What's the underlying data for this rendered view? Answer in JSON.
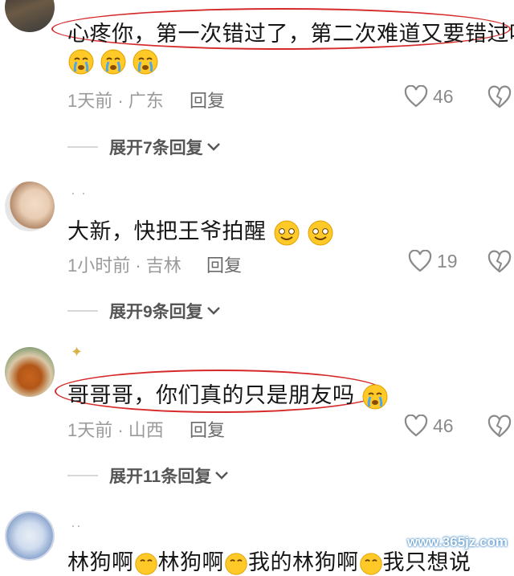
{
  "comments": [
    {
      "text": "心疼你，第一次错过了，第二次难道又要错过吗",
      "meta": "1天前 · 广东",
      "reply": "回复",
      "likes": "46",
      "expand": "展开7条回复",
      "emoji_count": 3
    },
    {
      "text": "大新，快把王爷拍醒",
      "meta": "1小时前 · 吉林",
      "reply": "回复",
      "likes": "19",
      "expand": "展开9条回复"
    },
    {
      "text": "哥哥哥，你们真的只是朋友吗",
      "meta": "1天前 · 山西",
      "reply": "回复",
      "likes": "46",
      "expand": "展开11条回复"
    },
    {
      "text_parts": [
        "林狗啊",
        "林狗啊",
        "我的林狗啊",
        "我只想说"
      ]
    }
  ],
  "watermark": "www.365jz.com",
  "colors": {
    "highlight_oval": "#d62a2a",
    "meta_text": "#9a9a9a"
  }
}
